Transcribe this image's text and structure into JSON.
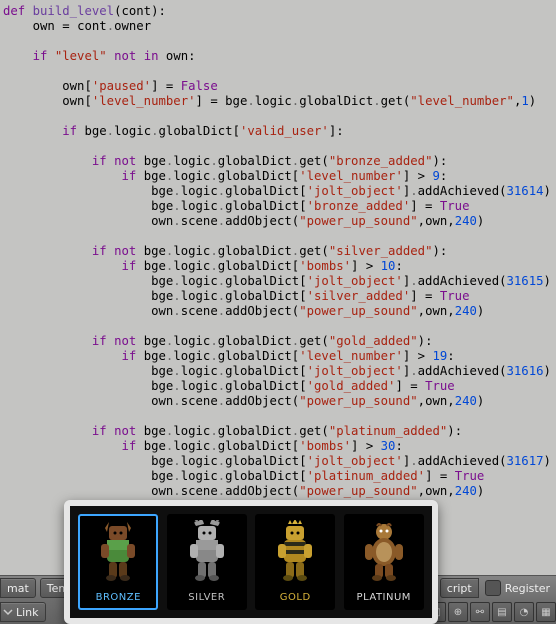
{
  "code": {
    "def": "def",
    "fn_name": "build_level",
    "param": "cont",
    "own": "own",
    "owner": "owner",
    "if": "if",
    "not": "not",
    "in": "in",
    "level_key": "\"level\"",
    "paused_key": "'paused'",
    "false_val": "False",
    "true_val": "True",
    "level_number_key": "'level_number'",
    "level_number_str": "\"level_number\"",
    "bge": "bge",
    "logic": "logic",
    "globalDict": "globalDict",
    "get": "get",
    "one": "1",
    "valid_user_key": "'valid_user'",
    "bronze_added_str": "\"bronze_added\"",
    "bronze_added_key": "'bronze_added'",
    "silver_added_str": "\"silver_added\"",
    "silver_added_key": "'silver_added'",
    "gold_added_str": "\"gold_added\"",
    "gold_added_key": "'gold_added'",
    "platinum_added_str": "\"platinum_added\"",
    "platinum_added_key": "'platinum_added'",
    "bombs_key": "'bombs'",
    "jolt_key": "'jolt_object'",
    "addAchieved": "addAchieved",
    "scene": "scene",
    "addObject": "addObject",
    "power_up_str": "\"power_up_sound\"",
    "thresh_9": "9",
    "thresh_10": "10",
    "thresh_19": "19",
    "thresh_30": "30",
    "id_bronze": "31614",
    "id_silver": "31615",
    "id_gold": "31616",
    "id_platinum": "31617",
    "vol_240": "240"
  },
  "toolbar": {
    "mat": "mat",
    "templates_label": "Tem",
    "script_label": "cript",
    "register_label": "Register",
    "link_label": "Link"
  },
  "popup": {
    "bronze": "BRONZE",
    "silver": "SILVER",
    "gold": "GOLD",
    "platinum": "PLATINUM"
  }
}
